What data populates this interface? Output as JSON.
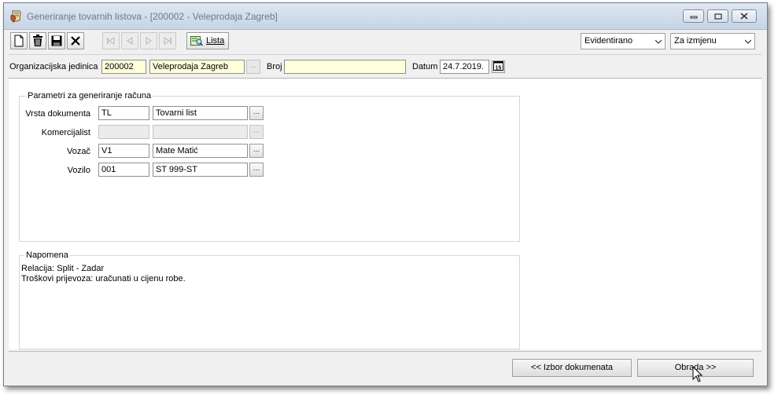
{
  "window": {
    "title": "Generiranje tovarnih listova - [200002 - Veleprodaja Zagreb]"
  },
  "toolbar": {
    "lista_label": "Lista",
    "status_select": "Evidentirano",
    "mode_select": "Za izmjenu"
  },
  "org": {
    "org_label": "Organizacijska jedinica",
    "org_code": "200002",
    "org_name": "Veleprodaja Zagreb",
    "broj_label": "Broj",
    "broj_value": "",
    "datum_label": "Datum",
    "datum_value": "24.7.2019."
  },
  "params": {
    "title": "Parametri za generiranje računa",
    "rows": [
      {
        "label": "Vrsta dokumenta",
        "code": "TL",
        "name": "Tovarni list"
      },
      {
        "label": "Komercijalist",
        "code": "",
        "name": ""
      },
      {
        "label": "Vozač",
        "code": "V1",
        "name": "Mate Matić"
      },
      {
        "label": "Vozilo",
        "code": "001",
        "name": "ST 999-ST"
      }
    ]
  },
  "notes": {
    "title": "Napomena",
    "lines": [
      "Relacija: Split - Zadar",
      "Troškovi prijevoza: uračunati u cijenu robe."
    ]
  },
  "footer": {
    "back_label": "<< Izbor dokumenata",
    "next_label": "Obrada >>"
  },
  "icons": {
    "app": "scroll-hand-icon",
    "new": "new-document-icon",
    "delete": "trash-icon",
    "save": "floppy-disk-icon",
    "cancel": "x-icon",
    "first": "first-record-icon",
    "prev": "previous-record-icon",
    "next": "next-record-icon",
    "last": "last-record-icon",
    "lista": "list-search-icon",
    "calendar": "calendar-icon",
    "minimize": "minimize-icon",
    "maximize": "maximize-icon",
    "close": "close-icon"
  },
  "colors": {
    "required_field": "#ffffdc",
    "title_text": "#6b7a8c"
  }
}
